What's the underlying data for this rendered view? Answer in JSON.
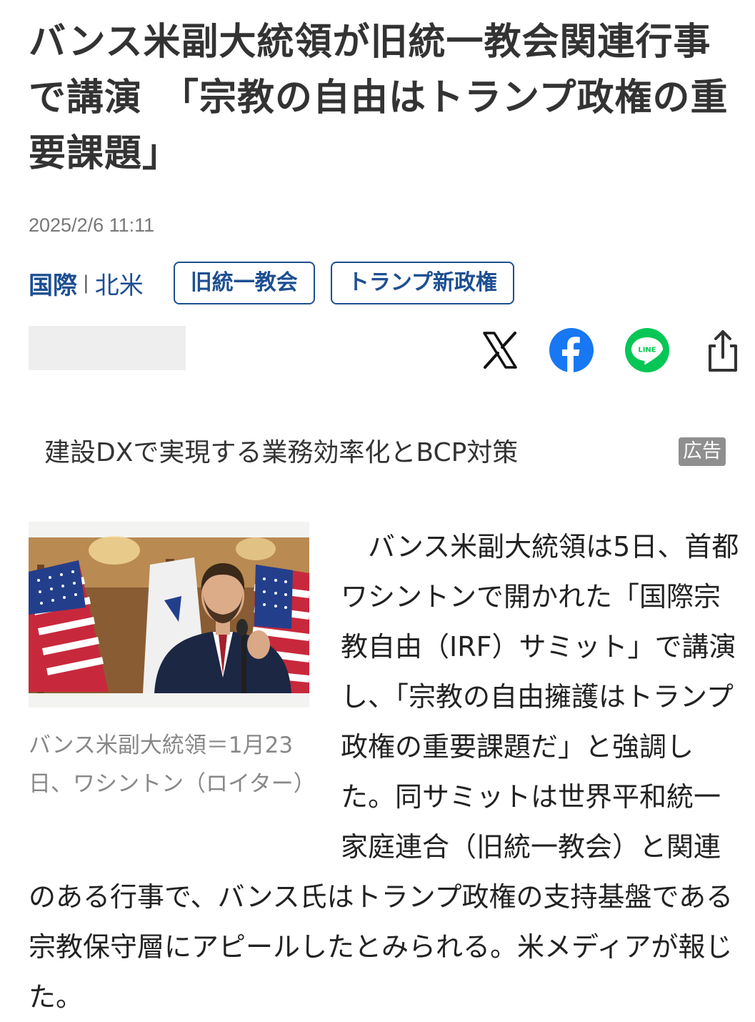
{
  "article": {
    "headline": "バンス米副大統領が旧統一教会関連行事で講演　「宗教の自由はトランプ政権の重要課題」",
    "date": "2025/2/6 11:11",
    "category_primary": "国際",
    "category_separator": "|",
    "category_secondary": "北米",
    "tags": [
      "旧統一教会",
      "トランプ新政権"
    ],
    "photo_caption": "バンス米副大統領＝1月23日、ワシントン（ロイター）",
    "body": "　バンス米副大統領は5日、首都ワシントンで開かれた「国際宗教自由（IRF）サミット」で講演し、「宗教の自由擁護はトランプ政権の重要課題だ」と強調した。同サミットは世界平和統一家庭連合（旧統一教会）と関連のある行事で、バンス氏はトランプ政権の支持基盤である宗教保守層にアピールしたとみられる。米メディアが報じた。"
  },
  "share": {
    "icons": [
      "x-icon",
      "facebook-icon",
      "line-icon",
      "share-icon"
    ],
    "line_icon_text": "LINE"
  },
  "ad": {
    "text": "建設DXで実現する業務効率化とBCP対策",
    "badge": "広告"
  },
  "colors": {
    "accent": "#1d4f91",
    "facebook": "#1877f2",
    "line": "#06c755",
    "ad_badge": "#8f8f8f"
  }
}
